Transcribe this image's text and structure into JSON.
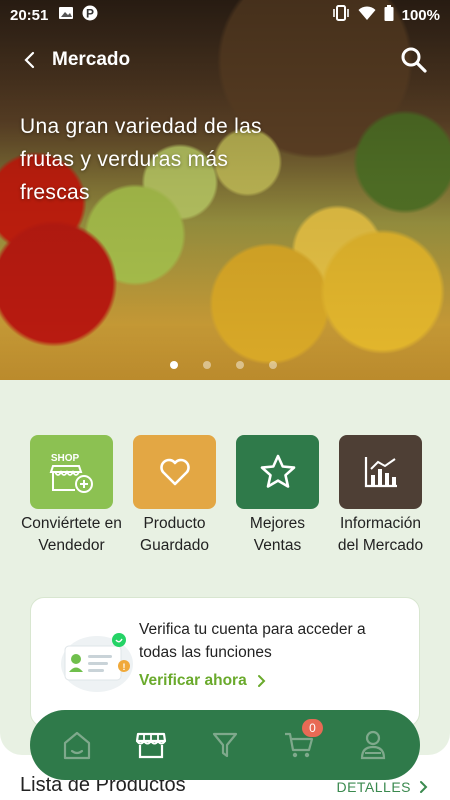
{
  "status_bar": {
    "time": "20:51",
    "battery": "100%",
    "icons": [
      "image-icon",
      "parking-icon",
      "vibrate-icon",
      "wifi-icon",
      "battery-icon"
    ]
  },
  "header": {
    "title": "Mercado"
  },
  "hero": {
    "headline": "Una gran variedad de las frutas y verduras más frescas",
    "slides_count": 4,
    "active_slide": 1
  },
  "tiles": [
    {
      "label": "Conviértete en Vendedor",
      "icon": "shop-icon",
      "color": "#8cc152",
      "icon_text": "SHOP"
    },
    {
      "label": "Producto Guardado",
      "icon": "heart-icon",
      "color": "#e3a744"
    },
    {
      "label": "Mejores Ventas",
      "icon": "star-icon",
      "color": "#2f7a4a"
    },
    {
      "label": "Información del Mercado",
      "icon": "chart-icon",
      "color": "#4e3f35"
    }
  ],
  "verify_card": {
    "text": "Verifica tu cuenta para acceder a todas las funciones",
    "link": "Verificar ahora"
  },
  "bottom_nav": {
    "items": [
      "home-icon",
      "store-icon",
      "filter-icon",
      "cart-icon",
      "profile-icon"
    ],
    "active": "store-icon",
    "cart_count": "0"
  },
  "product_list": {
    "title": "Lista de Productos",
    "details_label": "DETALLES"
  },
  "colors": {
    "accent_green": "#2f7a4a",
    "light_green_bg": "#e8f1e3",
    "link_green": "#6aaa2c",
    "badge_red": "#e86a55"
  }
}
